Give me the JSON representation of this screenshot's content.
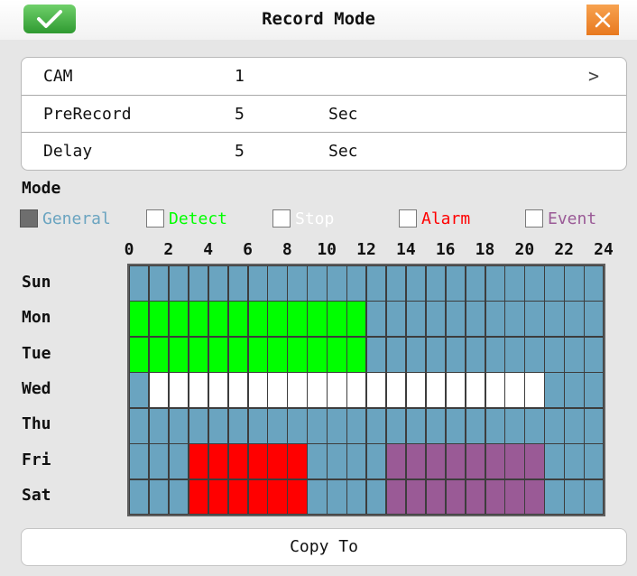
{
  "title": "Record Mode",
  "icons": {
    "ok": "checkmark-icon",
    "close": "close-x-icon",
    "chevron": "chevron-right-icon"
  },
  "colors": {
    "ok_green": "#3aa83a",
    "close_orange": "#ee8a2c",
    "cell_default": "#6aa4c0"
  },
  "settings": {
    "cam": {
      "label": "CAM",
      "value": "1",
      "chevron": ">"
    },
    "prerecord": {
      "label": "PreRecord",
      "value": "5",
      "unit": "Sec"
    },
    "delay": {
      "label": "Delay",
      "value": "5",
      "unit": "Sec"
    }
  },
  "mode_label": "Mode",
  "modes": [
    {
      "key": "general",
      "label": "General",
      "color": "#6aa4c0",
      "checked": true
    },
    {
      "key": "detect",
      "label": "Detect",
      "color": "#00ff00",
      "checked": false
    },
    {
      "key": "stop",
      "label": "Stop",
      "color": "#ffffff",
      "checked": false
    },
    {
      "key": "alarm",
      "label": "Alarm",
      "color": "#ff0000",
      "checked": false
    },
    {
      "key": "event",
      "label": "Event",
      "color": "#9a5a96",
      "checked": false
    }
  ],
  "hour_ticks": [
    "0",
    "2",
    "4",
    "6",
    "8",
    "10",
    "12",
    "14",
    "16",
    "18",
    "20",
    "22",
    "24"
  ],
  "days": [
    "Sun",
    "Mon",
    "Tue",
    "Wed",
    "Thu",
    "Fri",
    "Sat"
  ],
  "schedule_cells_per_hour": 1,
  "schedule": [
    "GGGGGGGGGGGGGGGGGGGGGGGG",
    "DDDDDDDDDDDDGGGGGGGGGGGG",
    "DDDDDDDDDDDDGGGGGGGGGGGG",
    "GSSSSSSSSSSSSSSSSSSSSGGG",
    "GGGGGGGGGGGGGGGGGGGGGGGG",
    "GGGAAAAAAGGGGEEEEEEEEGGG",
    "GGGAAAAAAGGGGEEEEEEEEGGG"
  ],
  "copy_button": "Copy To"
}
